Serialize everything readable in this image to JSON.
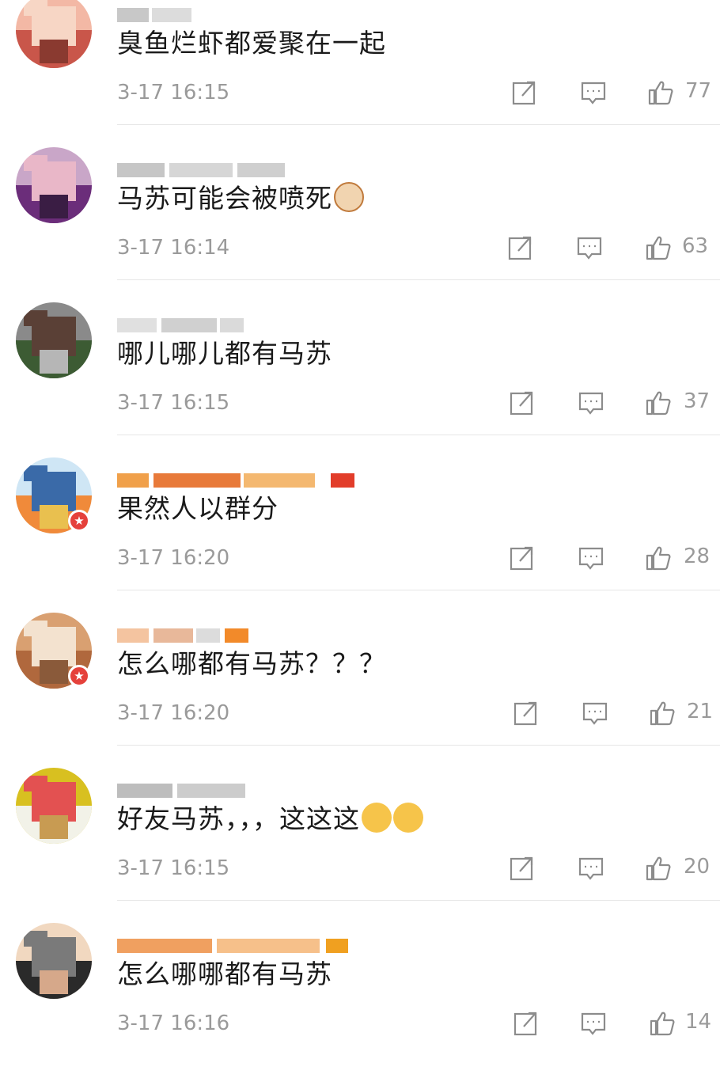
{
  "comments": [
    {
      "text": "臭鱼烂虾都爱聚在一起",
      "emoji": [],
      "time": "3-17 16:15",
      "likes": "77",
      "vip": false
    },
    {
      "text": "马苏可能会被喷死",
      "emoji": [
        "cat-face"
      ],
      "time": "3-17 16:14",
      "likes": "63",
      "vip": false
    },
    {
      "text": "哪儿哪儿都有马苏",
      "emoji": [],
      "time": "3-17 16:15",
      "likes": "37",
      "vip": false
    },
    {
      "text": "果然人以群分",
      "emoji": [],
      "time": "3-17 16:20",
      "likes": "28",
      "vip": true
    },
    {
      "text": "怎么哪都有马苏？？？",
      "emoji": [],
      "time": "3-17 16:20",
      "likes": "21",
      "vip": true
    },
    {
      "text": "好友马苏，，，这这这",
      "emoji": [
        "shush-face",
        "shush-face"
      ],
      "time": "3-17 16:15",
      "likes": "20",
      "vip": false
    },
    {
      "text": "怎么哪哪都有马苏",
      "emoji": [],
      "time": "3-17 16:16",
      "likes": "14",
      "vip": false
    }
  ],
  "icons": {
    "share": "share-icon",
    "reply": "comment-icon",
    "like": "thumbs-up-icon"
  },
  "colors": {
    "text": "#1a1a1a",
    "meta": "#9a9a9a",
    "divider": "#e6e6e6",
    "vip_badge": "#e5413b"
  }
}
